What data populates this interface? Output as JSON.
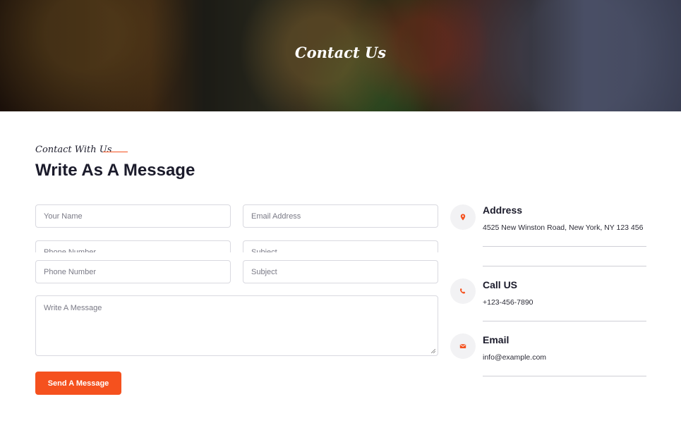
{
  "hero": {
    "title": "Contact Us"
  },
  "section": {
    "subtitle": "Contact With Us",
    "heading": "Write As A Message"
  },
  "form": {
    "name_placeholder": "Your Name",
    "email_placeholder": "Email Address",
    "phone_placeholder": "Phone Number",
    "subject_placeholder": "Subject",
    "message_placeholder": "Write A Message",
    "submit_label": "Send A Message"
  },
  "info": [
    {
      "icon": "location-pin-icon",
      "title": "Address",
      "value": "4525 New Winston Road, New York, NY 123 456"
    },
    {
      "icon": "phone-icon",
      "title": "Call US",
      "value": "+123-456-7890"
    },
    {
      "icon": "envelope-icon",
      "title": "Email",
      "value": "info@example.com"
    }
  ],
  "colors": {
    "accent": "#f5511e",
    "heading": "#1b1b2b",
    "border": "#d9d9e0"
  }
}
